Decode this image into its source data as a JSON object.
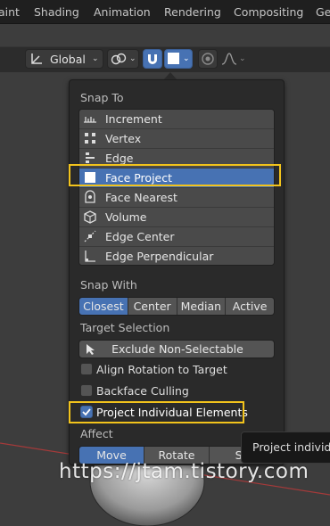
{
  "top_tabs": [
    "aint",
    "Shading",
    "Animation",
    "Rendering",
    "Compositing",
    "Ge"
  ],
  "toolbar": {
    "transform_orientation": "Global",
    "icons": [
      "transform-orientation-icon",
      "pivot-point-icon",
      "snap-magnet-icon",
      "snap-face-icon",
      "proportional-edit-icon",
      "falloff-curve-icon"
    ]
  },
  "popup": {
    "snap_to_title": "Snap To",
    "snap_to_items": [
      {
        "label": "Increment",
        "icon": "increment-icon"
      },
      {
        "label": "Vertex",
        "icon": "vertex-icon"
      },
      {
        "label": "Edge",
        "icon": "edge-icon"
      },
      {
        "label": "Face Project",
        "icon": "face-project-icon",
        "selected": true
      },
      {
        "label": "Face Nearest",
        "icon": "face-nearest-icon"
      },
      {
        "label": "Volume",
        "icon": "volume-icon"
      },
      {
        "label": "Edge Center",
        "icon": "edge-center-icon"
      },
      {
        "label": "Edge Perpendicular",
        "icon": "edge-perpendicular-icon"
      }
    ],
    "snap_with_title": "Snap With",
    "snap_with_options": [
      "Closest",
      "Center",
      "Median",
      "Active"
    ],
    "snap_with_selected": "Closest",
    "target_selection_title": "Target Selection",
    "exclude_non_selectable": "Exclude Non-Selectable",
    "align_rotation": {
      "label": "Align Rotation to Target",
      "checked": false
    },
    "backface_culling": {
      "label": "Backface Culling",
      "checked": false
    },
    "project_individual": {
      "label": "Project Individual Elements",
      "checked": true
    },
    "affect_title": "Affect",
    "affect_options": [
      "Move",
      "Rotate",
      "Sc"
    ],
    "affect_selected": "Move"
  },
  "tooltip": "Project individua",
  "watermark": "https://jtam.tistory.com",
  "colors": {
    "accent": "#4772b3",
    "highlight": "#f2c31c",
    "panel": "#2a2a2a",
    "viewport": "#3d3d3d"
  }
}
